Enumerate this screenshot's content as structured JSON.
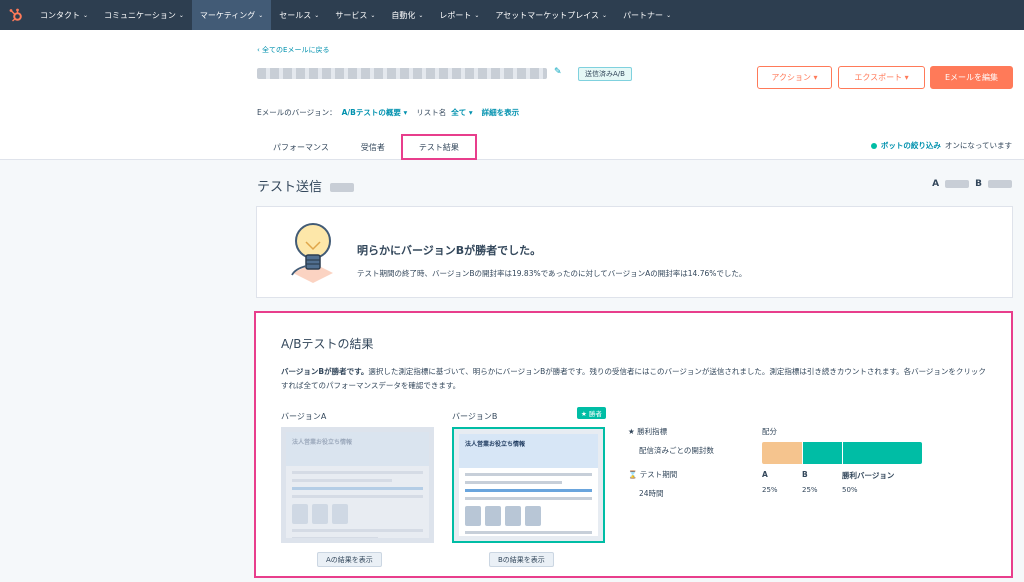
{
  "nav": {
    "items": [
      {
        "label": "コンタクト",
        "active": false
      },
      {
        "label": "コミュニケーション",
        "active": false
      },
      {
        "label": "マーケティング",
        "active": true
      },
      {
        "label": "セールス",
        "active": false
      },
      {
        "label": "サービス",
        "active": false
      },
      {
        "label": "自動化",
        "active": false
      },
      {
        "label": "レポート",
        "active": false
      },
      {
        "label": "アセットマーケットプレイス",
        "active": false
      },
      {
        "label": "パートナー",
        "active": false
      }
    ],
    "caret": "⌄",
    "logo_icon": "hubspot-sprocket-icon"
  },
  "header": {
    "back_link": "‹ 全てのEメールに戻る",
    "status_badge": "送信済みA/B",
    "actions_label": "アクション ▾",
    "export_label": "エクスポート ▾",
    "edit_label": "Eメールを編集",
    "version_label": "Eメールのバージョン：",
    "version_value": "A/Bテストの概要 ▾",
    "list_label": "リスト名",
    "list_value": "全て ▾",
    "details_link": "詳細を表示"
  },
  "tabs": [
    {
      "label": "パフォーマンス",
      "selected": false
    },
    {
      "label": "受信者",
      "selected": false
    },
    {
      "label": "テスト結果",
      "selected": true
    }
  ],
  "bot_filter": {
    "link": "ボットの絞り込み",
    "text": "オンになっています"
  },
  "section": {
    "title": "テスト送信",
    "a": "A",
    "b": "B"
  },
  "winner_card": {
    "title": "明らかにバージョンBが勝者でした。",
    "description": "テスト期間の終了時、バージョンBの開封率は19.83%であったのに対してバージョンAの開封率は14.76%でした。"
  },
  "results": {
    "title": "A/Bテストの結果",
    "desc_bold": "バージョンBが勝者です。",
    "desc_text": "選択した測定指標に基づいて、明らかにバージョンBが勝者です。残りの受信者にはこのバージョンが送信されました。測定指標は引き続きカウントされます。各バージョンをクリックすれば全てのパフォーマンスデータを確認できます。",
    "version_a_label": "バージョンA",
    "version_b_label": "バージョンB",
    "winner_badge": "★ 勝者",
    "mail_title": "法人営業お役立ち情報",
    "view_a": "Aの結果を表示",
    "view_b": "Bの結果を表示",
    "metric_heading": "勝利指標",
    "metric_value": "配信済みごとの開封数",
    "period_heading": "テスト期間",
    "period_value": "24時間",
    "distribution_heading": "配分",
    "distribution": [
      {
        "label": "A",
        "percent": 25,
        "pct_text": "25%",
        "color": "#f5c48e"
      },
      {
        "label": "B",
        "percent": 25,
        "pct_text": "25%",
        "color": "#00bda5"
      },
      {
        "label": "勝利バージョン",
        "percent": 50,
        "pct_text": "50%",
        "color": "#00bda5"
      }
    ]
  },
  "colors": {
    "accent": "#ff7a59",
    "teal": "#00bda5",
    "highlight": "#e83e8c",
    "nav_bg": "#2d3e50"
  }
}
